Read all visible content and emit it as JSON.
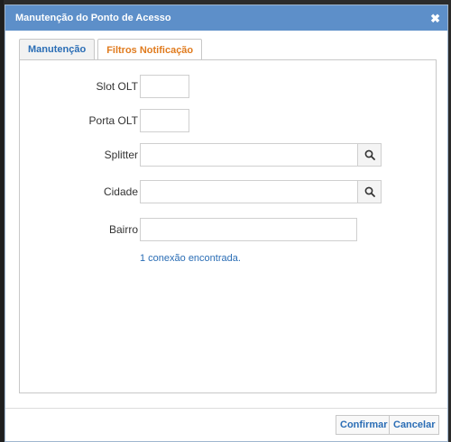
{
  "dialog": {
    "title": "Manutenção do Ponto de Acesso",
    "close_glyph": "✖"
  },
  "tabs": [
    {
      "label": "Manutenção",
      "active": false
    },
    {
      "label": "Filtros Notificação",
      "active": true
    }
  ],
  "form": {
    "slot_olt": {
      "label": "Slot OLT",
      "value": ""
    },
    "porta_olt": {
      "label": "Porta OLT",
      "value": ""
    },
    "splitter": {
      "label": "Splitter",
      "value": "",
      "search_icon": "search-icon"
    },
    "cidade": {
      "label": "Cidade",
      "value": "",
      "search_icon": "search-icon"
    },
    "bairro": {
      "label": "Bairro",
      "value": ""
    }
  },
  "result_text": "1 conexão encontrada.",
  "buttons": {
    "confirm": "Confirmar",
    "cancel": "Cancelar"
  },
  "colors": {
    "titlebar": "#5d8fc9",
    "link_blue": "#2a6db5",
    "active_tab": "#e07b1e"
  }
}
